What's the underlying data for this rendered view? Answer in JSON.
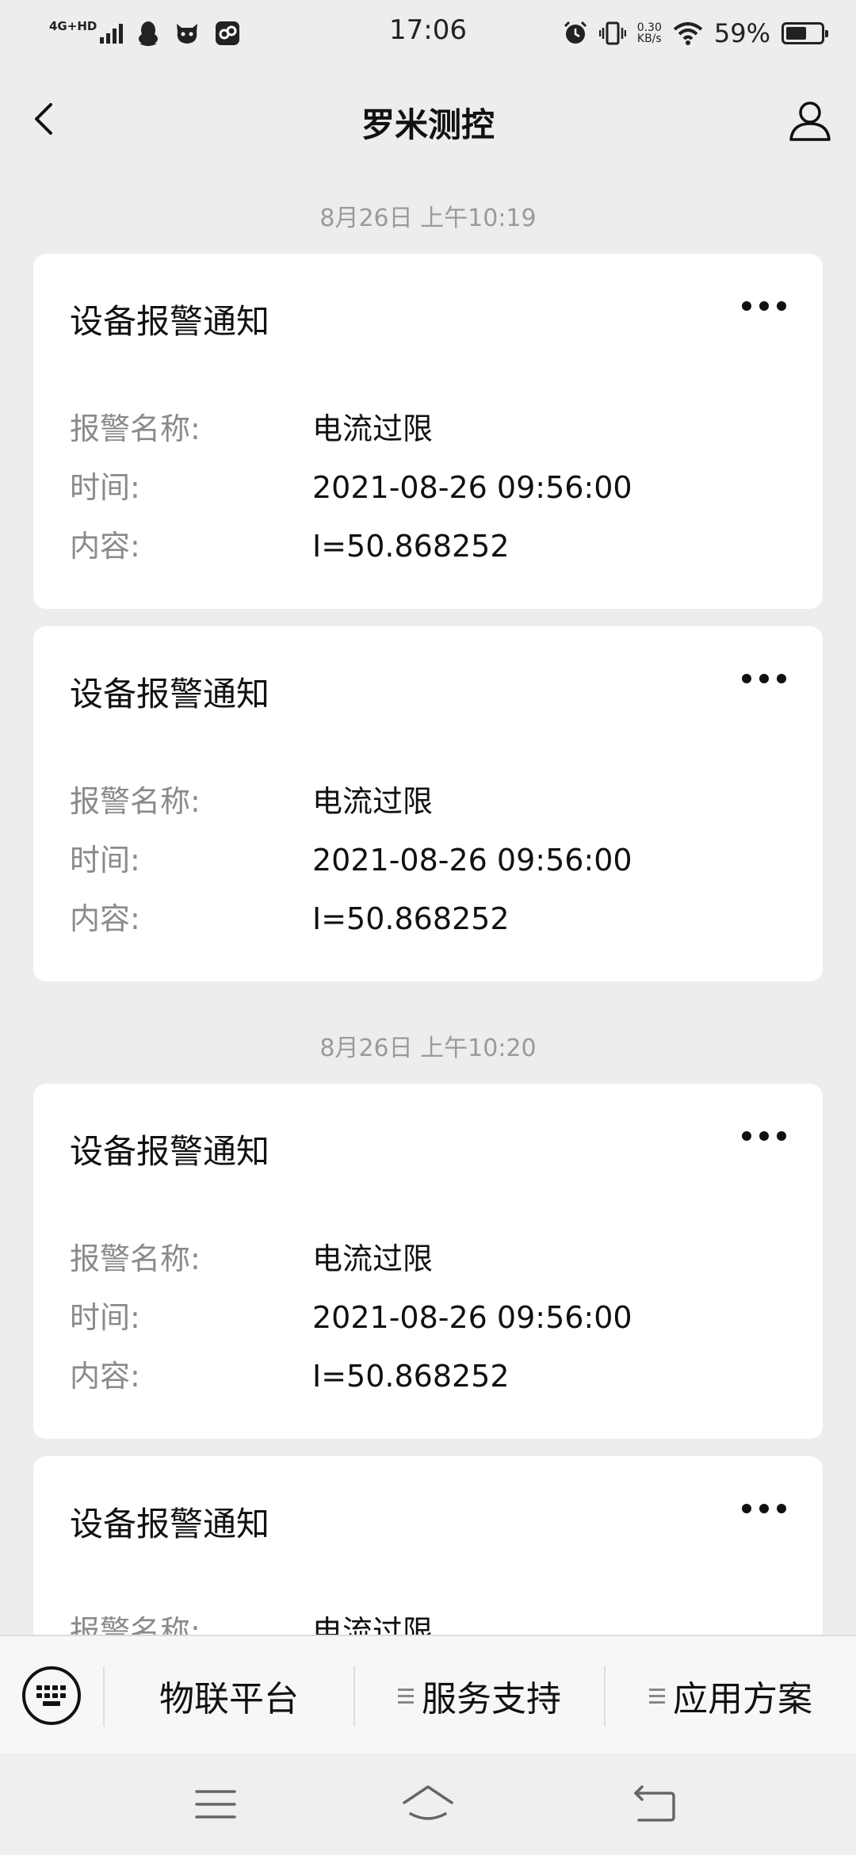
{
  "status_bar": {
    "network": "4G+HD",
    "time": "17:06",
    "speed_value": "0.30",
    "speed_unit": "KB/s",
    "battery_percent": "59%",
    "battery_level": 0.59
  },
  "header": {
    "title": "罗米测控"
  },
  "feed": {
    "timestamps": [
      "8月26日 上午10:19",
      "8月26日 上午10:20"
    ],
    "cards": [
      {
        "title": "设备报警通知",
        "alarm_label": "报警名称:",
        "alarm_value": "电流过限",
        "time_label": "时间:",
        "time_value": "2021-08-26 09:56:00",
        "content_label": "内容:",
        "content_value": "I=50.868252"
      },
      {
        "title": "设备报警通知",
        "alarm_label": "报警名称:",
        "alarm_value": "电流过限",
        "time_label": "时间:",
        "time_value": "2021-08-26 09:56:00",
        "content_label": "内容:",
        "content_value": "I=50.868252"
      },
      {
        "title": "设备报警通知",
        "alarm_label": "报警名称:",
        "alarm_value": "电流过限",
        "time_label": "时间:",
        "time_value": "2021-08-26 09:56:00",
        "content_label": "内容:",
        "content_value": "I=50.868252"
      },
      {
        "title": "设备报警通知",
        "alarm_label": "报警名称:",
        "alarm_value": "电流过限"
      }
    ]
  },
  "menu_bar": {
    "items": [
      "物联平台",
      "服务支持",
      "应用方案"
    ]
  },
  "icons": {
    "back": "chevron-left-icon",
    "profile": "user-icon",
    "more": "more-dots-icon",
    "keyboard": "keyboard-icon",
    "menu": "menu-lines-icon",
    "nav_menu": "hamburger-icon",
    "nav_home": "home-icon",
    "nav_back": "back-arrow-icon"
  }
}
